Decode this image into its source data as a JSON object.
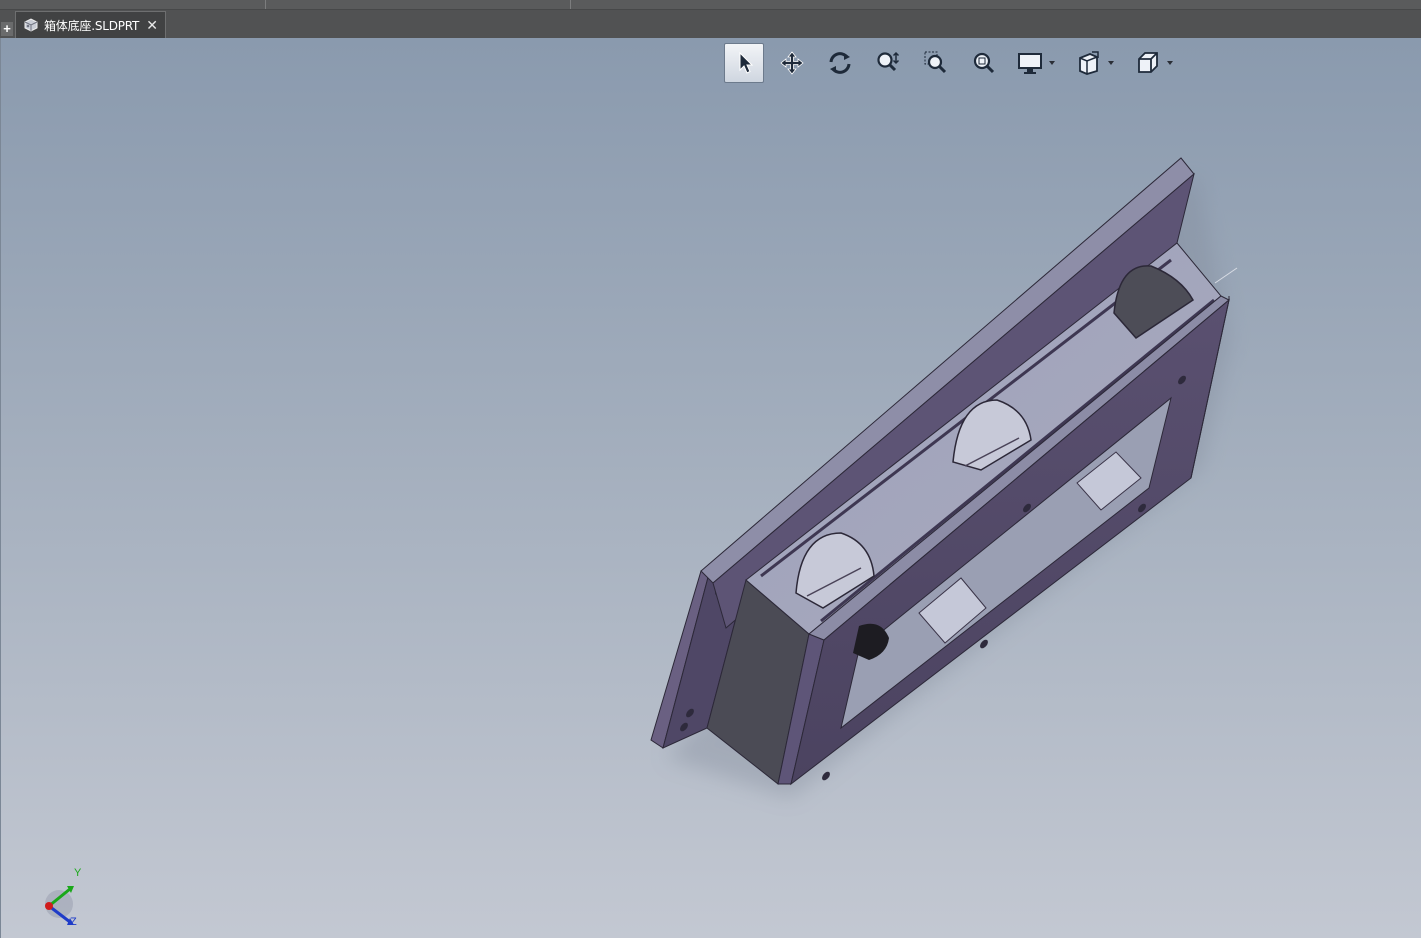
{
  "window": {
    "top_strip": {}
  },
  "tab_bar": {
    "add_symbol": "+",
    "tabs": [
      {
        "label": "箱体底座.SLDPRT",
        "icon": "part-icon",
        "close_symbol": "✕"
      }
    ]
  },
  "heads_up_toolbar": {
    "buttons": [
      {
        "name": "select",
        "icon": "pointer-icon",
        "active": true
      },
      {
        "name": "pan",
        "icon": "pan-icon"
      },
      {
        "name": "rotate",
        "icon": "rotate-icon"
      },
      {
        "name": "zoom-in-out",
        "icon": "zoom-in-out-icon"
      },
      {
        "name": "zoom-to-area",
        "icon": "zoom-to-area-icon"
      },
      {
        "name": "zoom-to-fit",
        "icon": "zoom-to-fit-icon"
      },
      {
        "name": "display-style",
        "icon": "display-monitor-icon",
        "dropdown": true
      },
      {
        "name": "hide-show-items",
        "icon": "hide-show-icon",
        "dropdown": true
      },
      {
        "name": "view-orientation",
        "icon": "view-cube-icon",
        "dropdown": true
      }
    ]
  },
  "triad": {
    "y_label": "Y",
    "z_label": "Z",
    "colors": {
      "y": "#1aa81a",
      "z": "#1f3cc8",
      "x": "#d01c1c"
    }
  },
  "colors": {
    "tab_bar": "#515253",
    "viewport_top": "#8a9aae",
    "viewport_bottom": "#c3c8d2",
    "model_light": "#a9acc2",
    "model_dark": "#4a4358"
  }
}
